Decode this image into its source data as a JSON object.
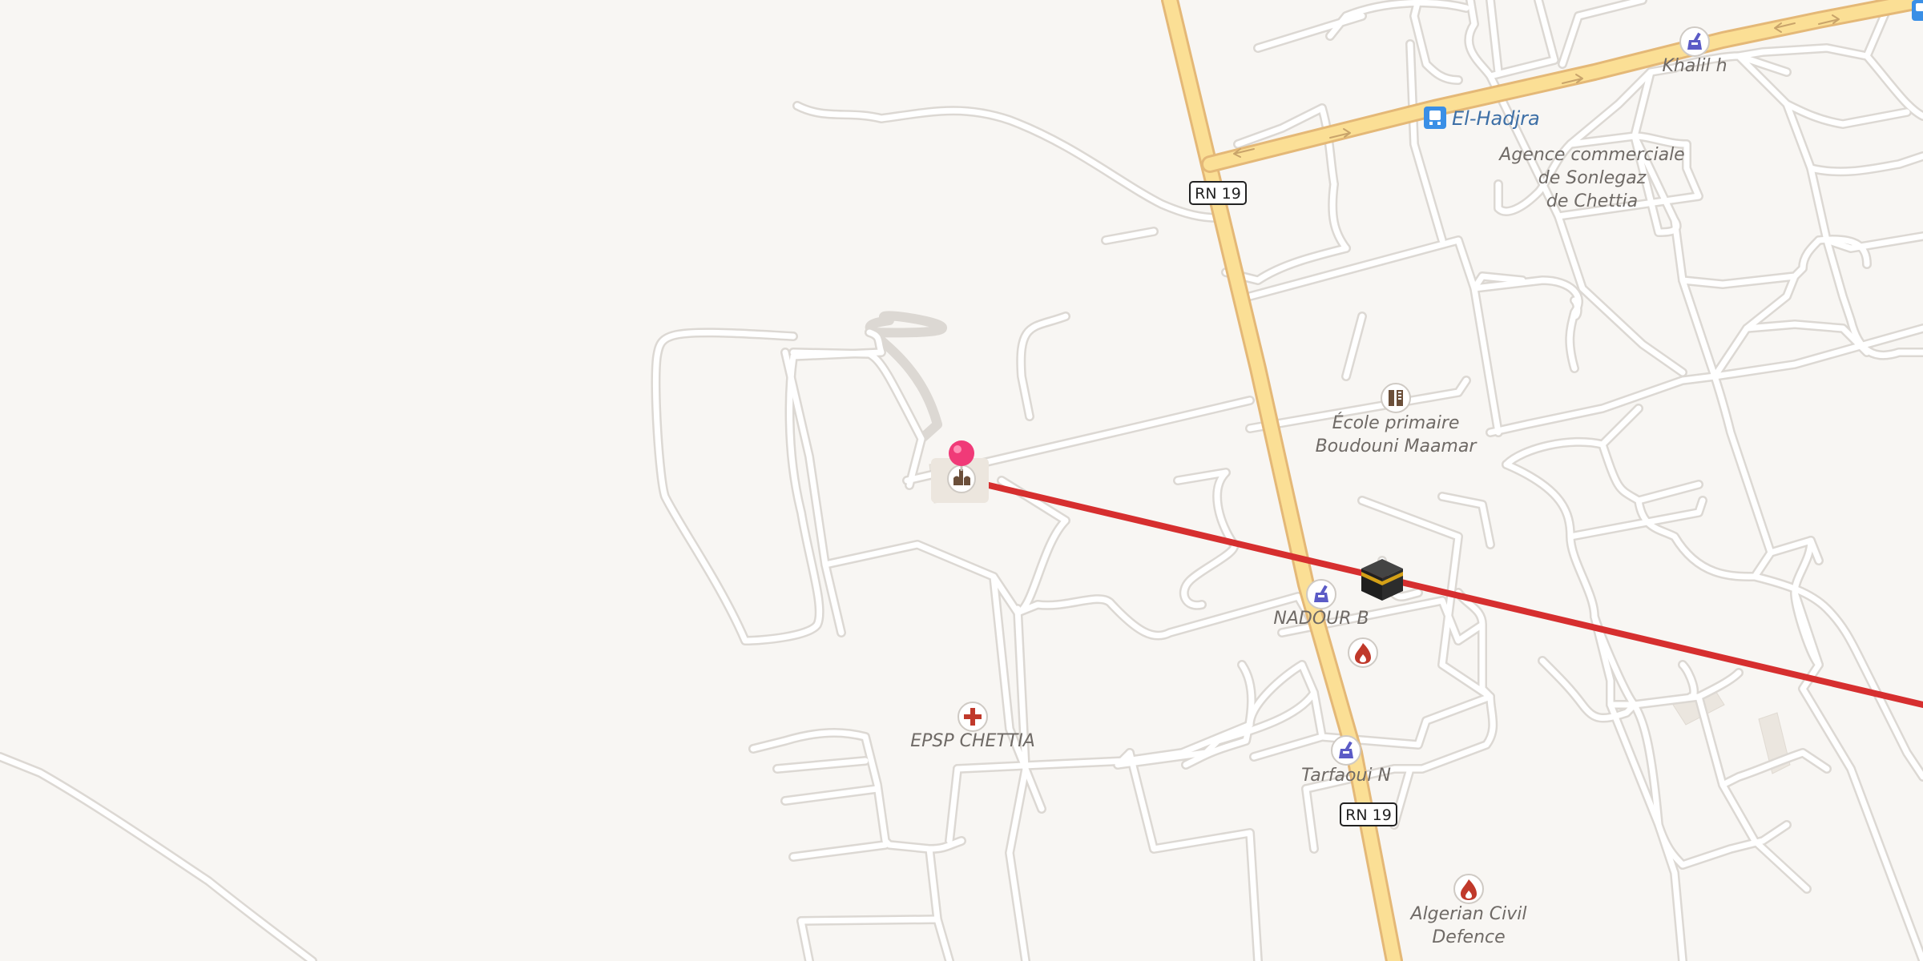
{
  "map": {
    "colors": {
      "background": "#f8f6f3",
      "road_casing": "#dcd8d3",
      "road_fill": "#ffffff",
      "highway_casing": "#e4b877",
      "highway_fill": "#fbdf95",
      "route_line": "#d62f2f",
      "pin": "#f03a78",
      "poi_pharmacy": "#5b5bc6",
      "poi_health": "#c0392b",
      "poi_fire": "#c0392b",
      "bus_stop": "#3a8fe6"
    },
    "road_shields": [
      {
        "id": "rn19-north",
        "text": "RN 19"
      },
      {
        "id": "rn19-south",
        "text": "RN 19"
      }
    ],
    "bus_stop": {
      "label": "El-Hadjra",
      "icon": "bus-icon"
    },
    "pois": [
      {
        "id": "khalil",
        "label": [
          "Khalil h"
        ],
        "icon": "pharmacy-icon"
      },
      {
        "id": "sonelgaz",
        "label": [
          "Agence commerciale",
          "de Sonlegaz",
          "de Chettia"
        ],
        "icon": ""
      },
      {
        "id": "ecole",
        "label": [
          "École primaire",
          "Boudouni Maamar"
        ],
        "icon": "school-icon"
      },
      {
        "id": "nadour",
        "label": [
          "NADOUR B"
        ],
        "icon": "pharmacy-icon"
      },
      {
        "id": "epsp",
        "label": [
          "EPSP CHETTIA"
        ],
        "icon": "hospital-cross-icon"
      },
      {
        "id": "tarfaoui",
        "label": [
          "Tarfaoui N"
        ],
        "icon": "pharmacy-icon"
      },
      {
        "id": "civil",
        "label": [
          "Algerian Civil",
          "Defence"
        ],
        "icon": "fire-station-icon"
      },
      {
        "id": "fire2",
        "label": [],
        "icon": "fire-station-icon"
      },
      {
        "id": "mosque",
        "label": [],
        "icon": "mosque-icon"
      }
    ],
    "kaaba_icon": "kaaba-qibla-icon",
    "pin_icon": "location-pin-icon"
  }
}
